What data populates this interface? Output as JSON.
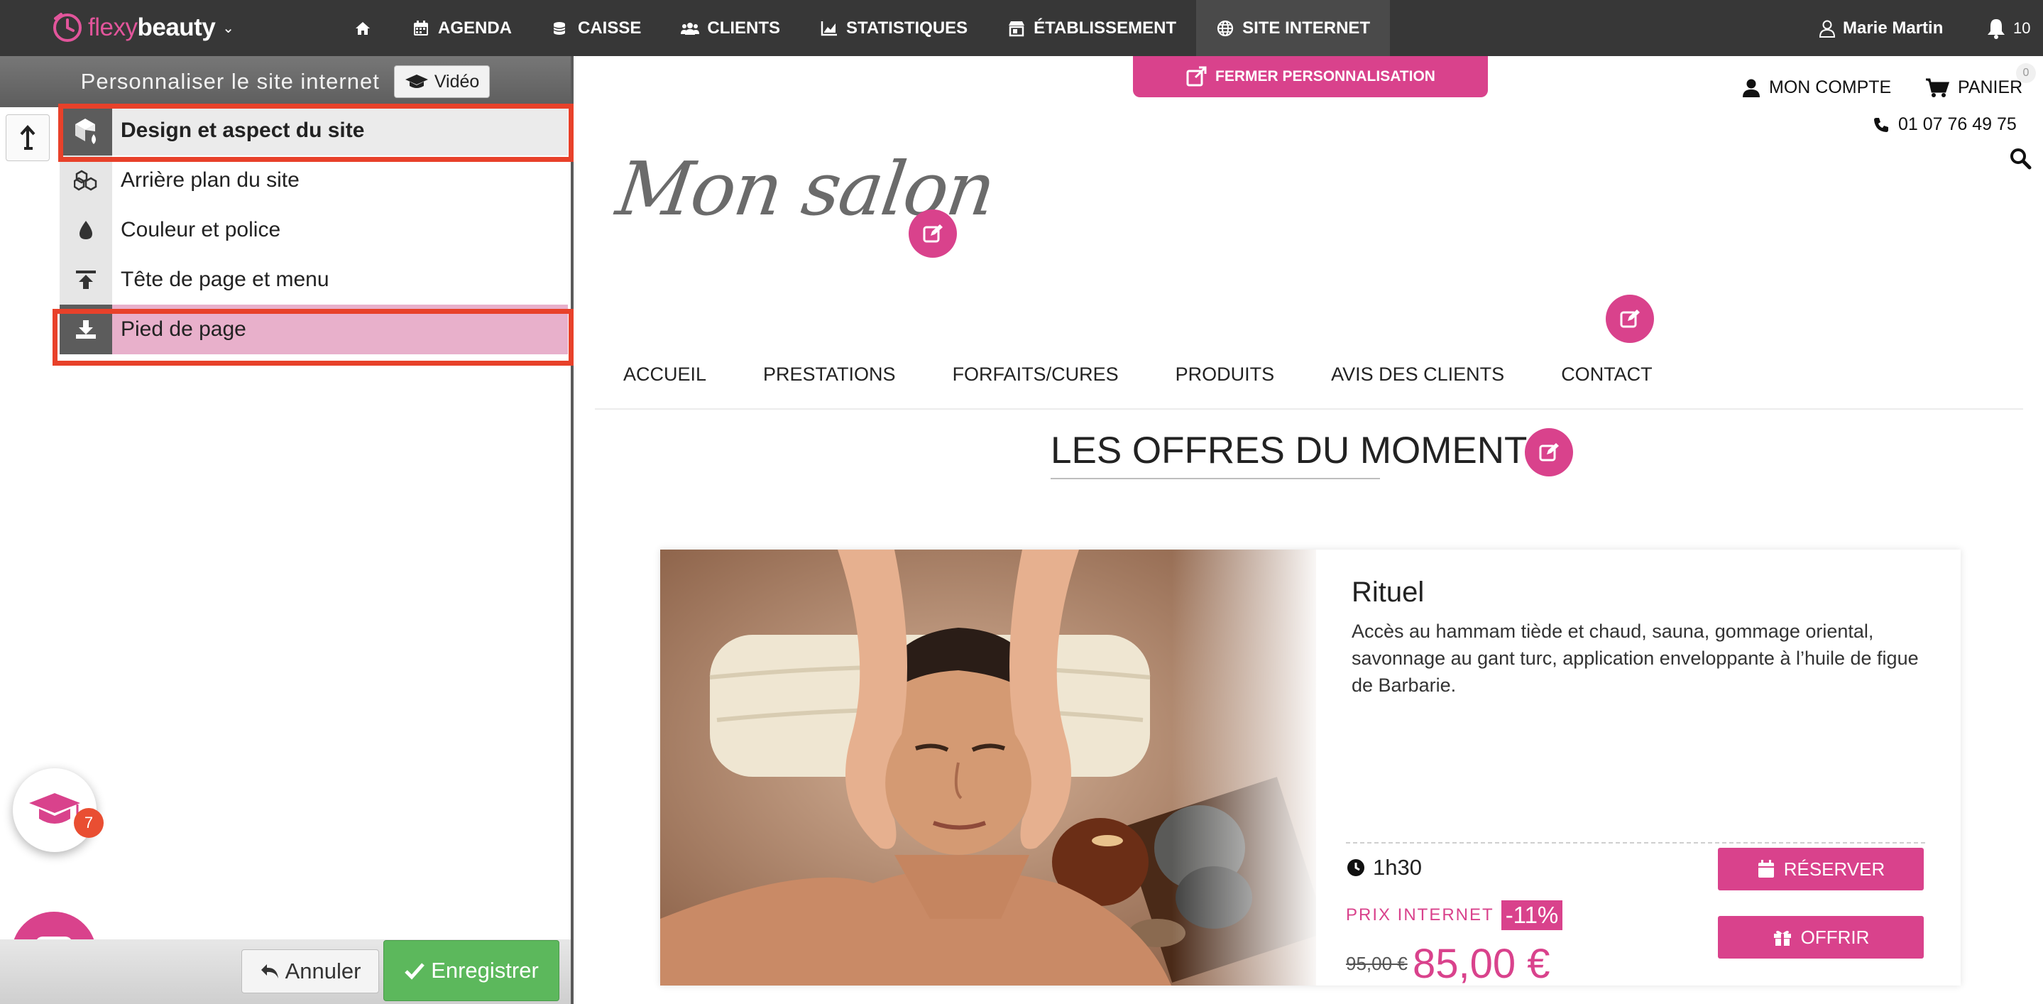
{
  "topbar": {
    "brand_prefix": "flexy",
    "brand_suffix": "beauty",
    "nav": [
      {
        "label": "AGENDA",
        "icon": "calendar-icon"
      },
      {
        "label": "CAISSE",
        "icon": "coins-icon"
      },
      {
        "label": "CLIENTS",
        "icon": "users-icon"
      },
      {
        "label": "STATISTIQUES",
        "icon": "chart-icon"
      },
      {
        "label": "ÉTABLISSEMENT",
        "icon": "store-icon"
      },
      {
        "label": "SITE INTERNET",
        "icon": "globe-icon",
        "active": true
      }
    ],
    "user_name": "Marie Martin",
    "notification_count": "10"
  },
  "panel": {
    "title": "Personnaliser le site internet",
    "video_label": "Vidéo",
    "items": [
      {
        "label": "Design et aspect du site",
        "icon": "design-icon",
        "highlighted": true
      },
      {
        "label": "Arrière plan du site",
        "icon": "background-icon"
      },
      {
        "label": "Couleur et police",
        "icon": "drop-icon"
      },
      {
        "label": "Tête de page et menu",
        "icon": "header-icon"
      },
      {
        "label": "Pied de page",
        "icon": "footer-icon",
        "selected": true,
        "highlighted": true
      }
    ],
    "help_badge": "7",
    "cancel_label": "Annuler",
    "save_label": "Enregistrer"
  },
  "site": {
    "close_label": "FERMER PERSONNALISATION",
    "account_label": "MON COMPTE",
    "cart_label": "PANIER",
    "cart_count": "0",
    "phone": "01 07 76 49 75",
    "salon_name": "Mon salon",
    "menu": [
      "ACCUEIL",
      "PRESTATIONS",
      "FORFAITS/CURES",
      "PRODUITS",
      "AVIS DES CLIENTS",
      "CONTACT"
    ],
    "offers_title": "LES OFFRES DU MOMENT",
    "offer": {
      "title": "Rituel",
      "description": "Accès au hammam tiède et chaud, sauna, gommage oriental, savonnage au gant turc, application enveloppante à l’huile de figue de Barbarie.",
      "duration": "1h30",
      "price_label": "PRIX INTERNET",
      "discount": "-11%",
      "old_price": "95,00 €",
      "new_price": "85,00 €",
      "book_label": "RÉSERVER",
      "gift_label": "OFFRIR"
    }
  },
  "colors": {
    "accent": "#d9428c",
    "topbar": "#373737",
    "highlight": "#e8412a",
    "save": "#5cb85c"
  }
}
